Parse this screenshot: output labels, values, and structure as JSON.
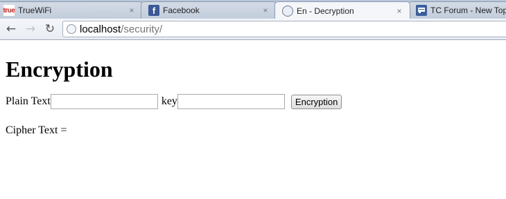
{
  "browser": {
    "tabs": [
      {
        "title": "TrueWiFi",
        "favicon": "true-logo-icon",
        "favicon_text": "true",
        "active": false
      },
      {
        "title": "Facebook",
        "favicon": "facebook-icon",
        "favicon_text": "f",
        "active": false
      },
      {
        "title": "En - Decryption",
        "favicon": "globe-icon",
        "active": true
      },
      {
        "title": "TC Forum - New Top",
        "favicon": "forum-icon",
        "active": false
      }
    ],
    "close_glyph": "×",
    "nav": {
      "back": "←",
      "forward": "→",
      "reload": "↻"
    },
    "url": {
      "host": "localhost",
      "path": "/security/"
    }
  },
  "page": {
    "heading": "Encryption",
    "plain_label": "Plain Text",
    "plain_value": "",
    "key_label": "key",
    "key_value": "",
    "submit_label": "Encryption",
    "result_label": "Cipher Text ="
  }
}
